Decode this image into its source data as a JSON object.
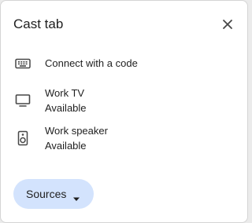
{
  "dialog": {
    "title": "Cast tab",
    "close_icon": "close-icon"
  },
  "items": [
    {
      "label": "Connect with a code",
      "status": "",
      "icon": "keyboard-icon"
    },
    {
      "label": "Work TV",
      "status": "Available",
      "icon": "tv-icon"
    },
    {
      "label": "Work speaker",
      "status": "Available",
      "icon": "speaker-icon"
    }
  ],
  "sources": {
    "label": "Sources",
    "icon": "dropdown-arrow-icon"
  },
  "colors": {
    "accent": "#d3e3fd",
    "text": "#1f1f1f",
    "icon": "#474747"
  }
}
